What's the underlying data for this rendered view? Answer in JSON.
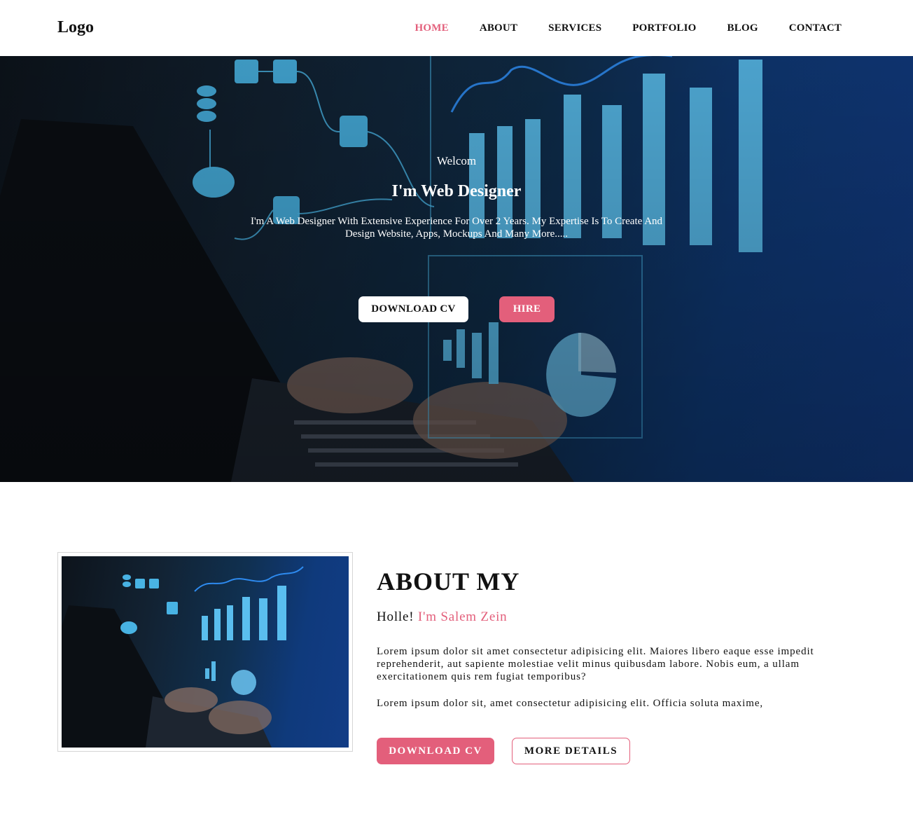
{
  "nav": {
    "logo": "Logo",
    "items": [
      {
        "label": "HOME",
        "active": true
      },
      {
        "label": "ABOUT"
      },
      {
        "label": "SERVICES"
      },
      {
        "label": "PORTFOLIO"
      },
      {
        "label": "BLOG"
      },
      {
        "label": "CONTACT"
      }
    ]
  },
  "hero": {
    "welcome": "Welcom",
    "title": "I'm Web Designer",
    "description": "I'm A Web Designer With Extensive Experience For Over 2 Years. My Expertise Is To Create And Design Website, Apps, Mockups And Many More.....",
    "download_label": "DOWNLOAD CV",
    "hire_label": "HIRE"
  },
  "about": {
    "title": "ABOUT MY",
    "hello": "Holle!",
    "name": "I'm Salem Zein",
    "paragraph1": "Lorem ipsum dolor sit amet consectetur adipisicing elit. Maiores libero eaque esse impedit reprehenderit, aut sapiente molestiae velit minus quibusdam labore. Nobis eum, a ullam exercitationem quis rem fugiat temporibus?",
    "paragraph2": "Lorem ipsum dolor sit, amet consectetur adipisicing elit. Officia soluta maxime,",
    "download_label": "DOWNLOAD CV",
    "details_label": "MORE DETAILS"
  },
  "colors": {
    "accent": "#e35f7b",
    "hero_dark": "#122232",
    "hero_blue": "#0f3a78"
  }
}
